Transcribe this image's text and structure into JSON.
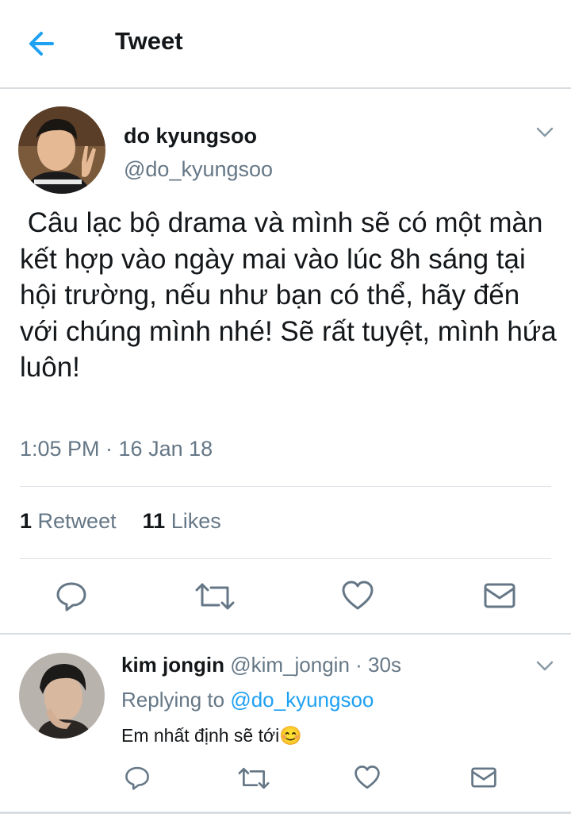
{
  "header": {
    "title": "Tweet",
    "back_icon": "arrow-left-icon",
    "accent": "#1da1f2"
  },
  "tweet": {
    "author_name": "do kyungsoo",
    "author_handle": "@do_kyungsoo",
    "text": " Câu lạc bộ drama và mình sẽ có một màn kết hợp vào ngày mai vào lúc 8h sáng tại hội trường, nếu như bạn có thể, hãy đến với chúng mình nhé! Sẽ rất tuyệt, mình hứa luôn!",
    "timestamp": "1:05 PM · 16 Jan 18",
    "retweet_count": "1",
    "retweet_label": "Retweet",
    "like_count": "11",
    "like_label": "Likes",
    "actions": [
      "reply-icon",
      "retweet-icon",
      "like-icon",
      "direct-message-icon"
    ]
  },
  "reply": {
    "author_name": "kim jongin",
    "author_handle": "@kim_jongin",
    "time_ago": "· 30s",
    "replying_prefix": "Replying to",
    "replying_to": "@do_kyungsoo",
    "text": "Em nhất định sẽ tới",
    "emoji": "😊",
    "actions": [
      "reply-icon",
      "retweet-icon",
      "like-icon",
      "direct-message-icon"
    ]
  },
  "colors": {
    "text": "#14171a",
    "secondary": "#657786",
    "link": "#1da1f2",
    "icon": "#657786"
  }
}
